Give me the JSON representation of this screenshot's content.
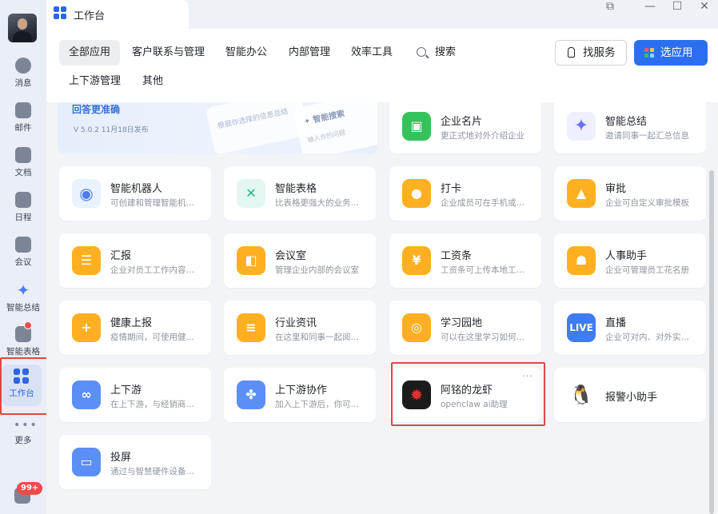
{
  "sidebar": {
    "items": [
      {
        "label": "消息",
        "icon": "chat-bubble-icon"
      },
      {
        "label": "邮件",
        "icon": "mail-icon"
      },
      {
        "label": "文档",
        "icon": "docs-icon"
      },
      {
        "label": "日程",
        "icon": "calendar-icon"
      },
      {
        "label": "会议",
        "icon": "meeting-icon"
      },
      {
        "label": "智能总结",
        "icon": "sparkle-icon"
      },
      {
        "label": "智能表格",
        "icon": "smart-sheet-icon"
      },
      {
        "label": "工作台",
        "icon": "workbench-grid-icon"
      }
    ],
    "more_label": "更多",
    "bottom_badge": "99+"
  },
  "window": {
    "tab_title": "工作台"
  },
  "categories": [
    "全部应用",
    "客户联系与管理",
    "智能办公",
    "内部管理",
    "效率工具",
    "上下游管理",
    "其他"
  ],
  "search_label": "搜索",
  "find_service_label": "找服务",
  "add_app_label": "选应用",
  "banner": {
    "text": "回答更准确",
    "version": "V 5.0.2  11月18日发布",
    "card_hint": "根据你选择的信息总结",
    "search_title": "✦ 智能搜索",
    "input_hint": "输入你的问题"
  },
  "apps": [
    {
      "name": "企业名片",
      "desc": "更正式地对外介绍企业",
      "color": "#34c35a",
      "glyph": "▣"
    },
    {
      "name": "智能总结",
      "desc": "邀请同事一起汇总信息",
      "color": "#eef0ff",
      "glyph": "✦"
    },
    {
      "name": "智能机器人",
      "desc": "可创建和管理智能机器人",
      "color": "#eaf1ff",
      "glyph": "◉"
    },
    {
      "name": "智能表格",
      "desc": "比表格更强大的业务管理",
      "color": "#e4f6f1",
      "glyph": "✕"
    },
    {
      "name": "打卡",
      "desc": "企业成员可在手机或电脑打卡",
      "color": "#ffb020",
      "glyph": "●"
    },
    {
      "name": "审批",
      "desc": "企业可自定义审批模板",
      "color": "#ffb020",
      "glyph": "▲"
    },
    {
      "name": "汇报",
      "desc": "企业对员工工作内容进行汇报",
      "color": "#ffb020",
      "glyph": "☰"
    },
    {
      "name": "会议室",
      "desc": "管理企业内部的会议室",
      "color": "#ffb020",
      "glyph": "◧"
    },
    {
      "name": "工资条",
      "desc": "工资条可上传本地工资表",
      "color": "#ffb020",
      "glyph": "¥"
    },
    {
      "name": "人事助手",
      "desc": "企业可管理员工花名册",
      "color": "#ffb020",
      "glyph": "☗"
    },
    {
      "name": "健康上报",
      "desc": "疫情期间，可使用健康上报",
      "color": "#ffb020",
      "glyph": "+"
    },
    {
      "name": "行业资讯",
      "desc": "在这里和同事一起阅读资讯",
      "color": "#ffb020",
      "glyph": "≡"
    },
    {
      "name": "学习园地",
      "desc": "可以在这里学习如何使用",
      "color": "#ffb020",
      "glyph": "◎"
    },
    {
      "name": "直播",
      "desc": "企业可对内、对外实时直播",
      "color": "#3f7cf4",
      "glyph": "LIVE"
    },
    {
      "name": "上下游",
      "desc": "在上下游，与经销商、供应商",
      "color": "#5b8ff5",
      "glyph": "∞"
    },
    {
      "name": "上下游协作",
      "desc": "加入上下游后，你可以协作",
      "color": "#5b8ff5",
      "glyph": "✤"
    },
    {
      "name": "阿铭的龙虾",
      "desc": "openclaw ai助理",
      "color": "#1b1b1b",
      "glyph": "✹"
    },
    {
      "name": "报警小助手",
      "desc": "",
      "color": "#ffffff",
      "glyph": "🐧"
    },
    {
      "name": "投屏",
      "desc": "通过与智慧硬件设备进行投屏",
      "color": "#5b8ff5",
      "glyph": "▭"
    }
  ],
  "colors": {
    "accent": "#2b66e6",
    "highlight_border": "#e34545",
    "badge": "#f24b4b"
  }
}
